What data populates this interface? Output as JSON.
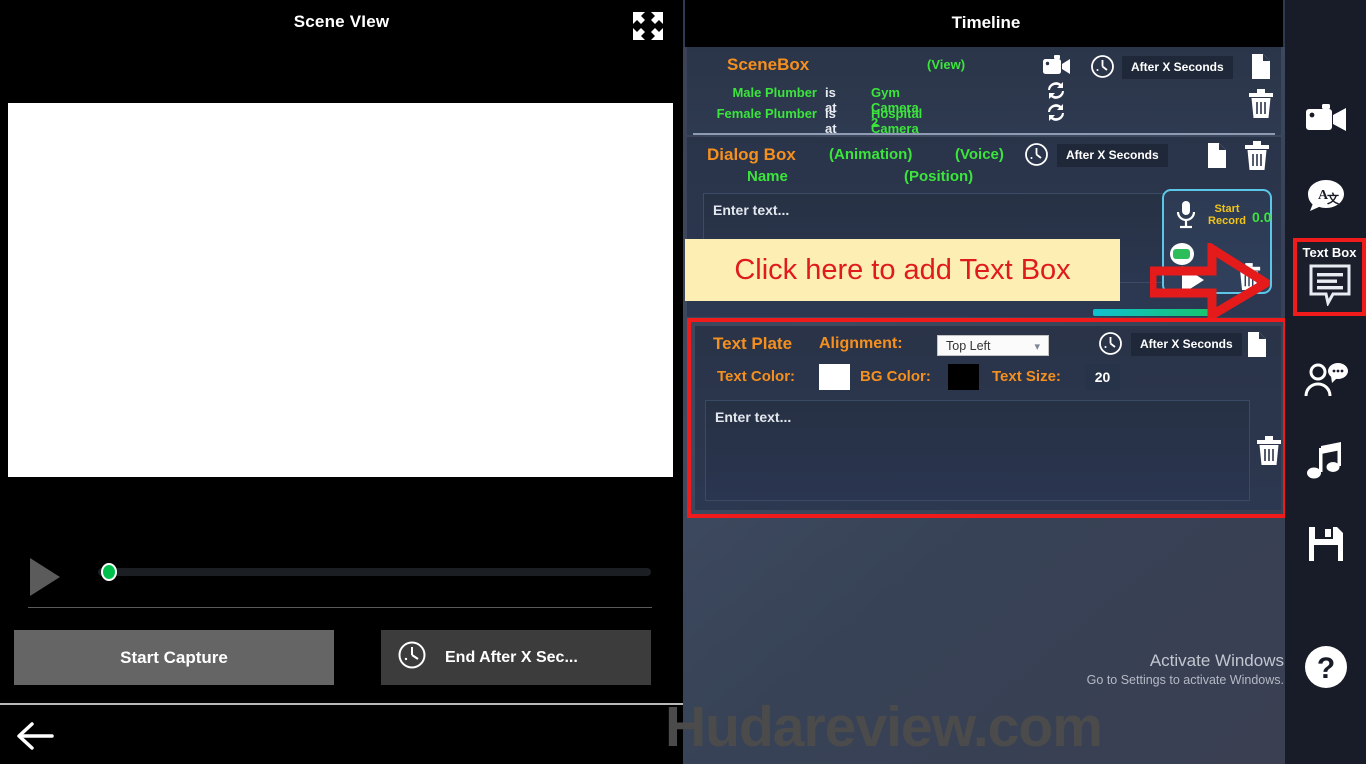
{
  "scene_panel": {
    "title": "Scene VIew",
    "fullscreen_icon": "expand-icon",
    "play_icon": "play-icon",
    "start_capture_label": "Start Capture",
    "end_after_label": "End After X Sec...",
    "end_after_icon": "clock-icon",
    "back_icon": "back-arrow-icon",
    "seek_value": 0
  },
  "timeline": {
    "title": "Timeline",
    "scenebox": {
      "title": "SceneBox",
      "view_label": "(View)",
      "camera_icon": "video-camera-icon",
      "clock_icon": "clock-icon",
      "after_x_seconds": "After X Seconds",
      "duplicate_icon": "document-icon",
      "delete_icon": "trash-icon",
      "rows": [
        {
          "name": "Male Plumber",
          "relation": "is at",
          "target": "Gym Camera 2",
          "sync_icon": "sync-icon"
        },
        {
          "name": "Female Plumber",
          "relation": "is at",
          "target": "Hospital Camera 2",
          "sync_icon": "sync-icon"
        }
      ]
    },
    "dialog_box": {
      "title": "Dialog Box",
      "name_label": "Name",
      "animation_label": "(Animation)",
      "voice_label": "(Voice)",
      "position_label": "(Position)",
      "clock_icon": "clock-icon",
      "after_x_seconds": "After X Seconds",
      "duplicate_icon": "document-icon",
      "delete_icon": "trash-icon",
      "text_placeholder": "Enter text...",
      "text_value": "",
      "record": {
        "mic_icon": "microphone-icon",
        "start_record_line1": "Start",
        "start_record_line2": "Record",
        "time": "0.0",
        "record_icon": "record-icon",
        "play_icon": "play-icon",
        "delete_icon": "trash-icon"
      }
    },
    "callout": {
      "text": "Click here to add Text Box",
      "arrow_icon": "right-arrow-icon"
    },
    "text_plate": {
      "title": "Text Plate",
      "alignment_label": "Alignment:",
      "alignment_value": "Top Left",
      "alignment_chevron": "chevron-down-icon",
      "text_color_label": "Text Color:",
      "text_color_value": "#ffffff",
      "bg_color_label": "BG Color:",
      "bg_color_value": "#000000",
      "text_size_label": "Text Size:",
      "text_size_value": "20",
      "clock_icon": "clock-icon",
      "after_x_seconds": "After X Seconds",
      "duplicate_icon": "document-icon",
      "delete_icon": "trash-icon",
      "text_placeholder": "Enter text...",
      "text_value": ""
    },
    "activate_windows": {
      "line1": "Activate Windows",
      "line2": "Go to Settings to activate Windows."
    }
  },
  "sidebar": {
    "items": [
      {
        "label": "",
        "icon": "video-camera-icon",
        "name": "sidebar-item-camera"
      },
      {
        "label": "",
        "icon": "translate-icon",
        "name": "sidebar-item-translate"
      },
      {
        "label": "Text Box",
        "icon": "text-box-icon",
        "name": "sidebar-item-text-box",
        "selected": true
      },
      {
        "label": "",
        "icon": "character-dialog-icon",
        "name": "sidebar-item-character"
      },
      {
        "label": "",
        "icon": "music-note-icon",
        "name": "sidebar-item-music"
      },
      {
        "label": "",
        "icon": "save-disk-icon",
        "name": "sidebar-item-save"
      },
      {
        "label": "",
        "icon": "help-question-icon",
        "name": "sidebar-item-help"
      }
    ]
  },
  "watermark": {
    "text": "Hudareview.com"
  },
  "colors": {
    "accent_orange": "#f5901e",
    "accent_green": "#3be53b",
    "highlight_red": "#f11b1b",
    "callout_bg": "#fdeeb4",
    "callout_text": "#e01b1b"
  }
}
